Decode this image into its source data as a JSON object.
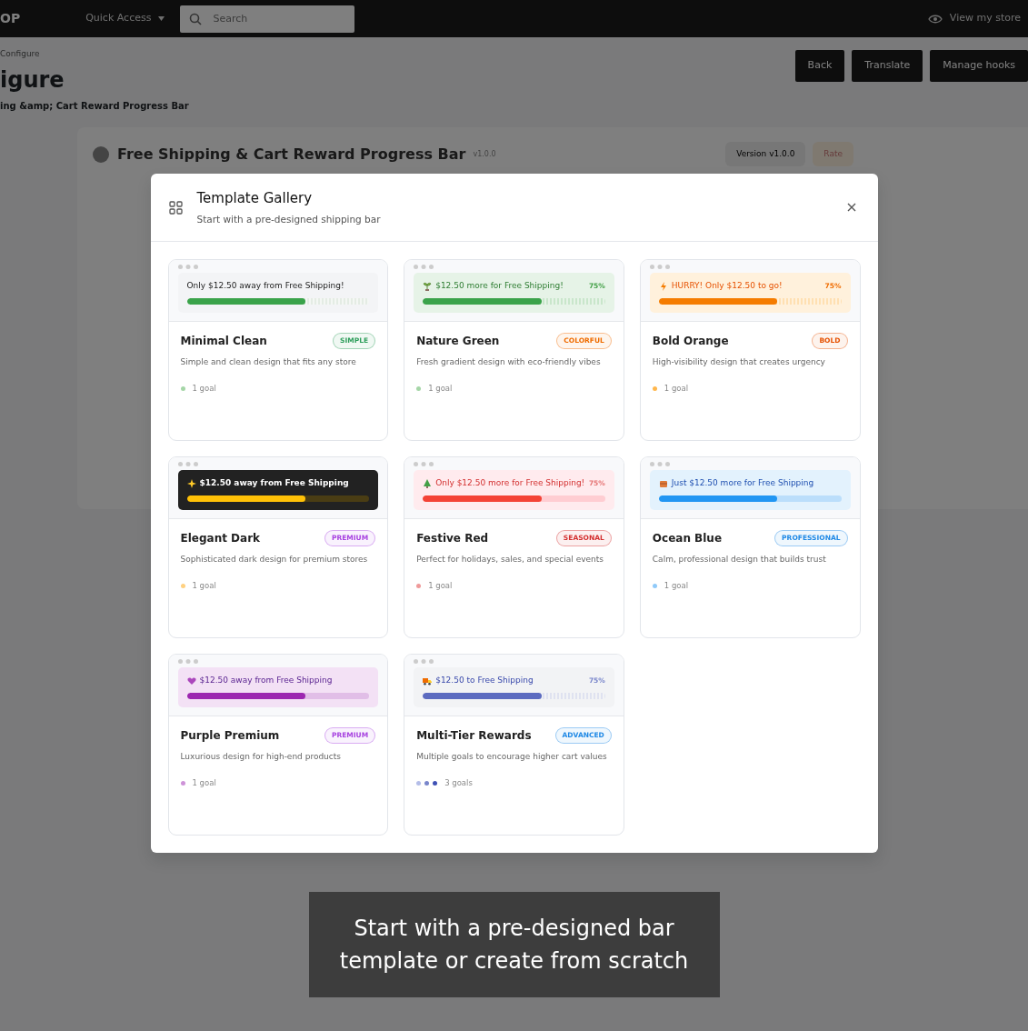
{
  "background": {
    "topbar": {
      "brand": "OP",
      "quick_access": "Quick Access",
      "search_placeholder": "Search",
      "view_store": "View my store"
    },
    "breadcrumb": "Configure",
    "title": "igure",
    "subtitle": "ing &amp; Cart Reward Progress Bar",
    "buttons": [
      "Back",
      "Translate",
      "Manage hooks"
    ],
    "module": {
      "name": "Free Shipping & Cart Reward Progress Bar",
      "version": "v1.0.0",
      "version_button": "Version v1.0.0",
      "rate_button": "Rate"
    }
  },
  "modal": {
    "title": "Template Gallery",
    "subtitle": "Start with a pre-designed shipping bar",
    "templates": [
      {
        "kind": "minimal",
        "message": "Only $12.50 away from Free Shipping!",
        "level": 0.65,
        "color": "#3aa34a",
        "name": "Minimal Clean",
        "badge": {
          "label": "SIMPLE",
          "color": "#2e9e5b"
        },
        "description": "Simple and clean design that fits any store",
        "goal_dots": [
          {
            "color": "#a5d6a7"
          }
        ],
        "goals": "1 goal"
      },
      {
        "kind": "nature",
        "message": "$12.50 more for Free Shipping!",
        "percent": "75%",
        "level": 0.65,
        "color": "#3aa34a",
        "name": "Nature Green",
        "badge": {
          "label": "COLORFUL",
          "color": "#ef6c00"
        },
        "description": "Fresh gradient design with eco-friendly vibes",
        "goal_dots": [
          {
            "color": "#a5d6a7"
          }
        ],
        "goals": "1 goal"
      },
      {
        "kind": "orange",
        "message": "HURRY! Only $12.50 to go!",
        "percent": "75%",
        "level": 0.65,
        "color": "#f57c00",
        "name": "Bold Orange",
        "badge": {
          "label": "BOLD",
          "color": "#e65100"
        },
        "description": "High-visibility design that creates urgency",
        "goal_dots": [
          {
            "color": "#ffb74d"
          }
        ],
        "goals": "1 goal"
      },
      {
        "kind": "dark",
        "message": "$12.50 away from Free Shipping",
        "level": 0.65,
        "color": "#ffc107",
        "name": "Elegant Dark",
        "badge": {
          "label": "PREMIUM",
          "color": "#a742e0"
        },
        "description": "Sophisticated dark design for premium stores",
        "goal_dots": [
          {
            "color": "#ffd180"
          }
        ],
        "goals": "1 goal"
      },
      {
        "kind": "red",
        "message": "Only $12.50 more for Free Shipping!",
        "percent": "75%",
        "level": 0.65,
        "color": "#f44336",
        "name": "Festive Red",
        "badge": {
          "label": "SEASONAL",
          "color": "#d32f2f"
        },
        "description": "Perfect for holidays, sales, and special events",
        "goal_dots": [
          {
            "color": "#ef9a9a"
          }
        ],
        "goals": "1 goal"
      },
      {
        "kind": "blue",
        "message": "Just $12.50 more for Free Shipping",
        "level": 0.65,
        "color": "#2196f3",
        "name": "Ocean Blue",
        "badge": {
          "label": "PROFESSIONAL",
          "color": "#1e88e5"
        },
        "description": "Calm, professional design that builds trust",
        "goal_dots": [
          {
            "color": "#90caf9"
          }
        ],
        "goals": "1 goal"
      },
      {
        "kind": "purple",
        "message": "$12.50 away from Free Shipping",
        "level": 0.65,
        "color": "#9c27b0",
        "name": "Purple Premium",
        "badge": {
          "label": "PREMIUM",
          "color": "#a742e0"
        },
        "description": "Luxurious design for high-end products",
        "goal_dots": [
          {
            "color": "#ce93d8"
          }
        ],
        "goals": "1 goal"
      },
      {
        "kind": "multi",
        "message": "$12.50 to Free Shipping",
        "percent": "75%",
        "level": 0.65,
        "color": "#5c6bc0",
        "name": "Multi-Tier Rewards",
        "badge": {
          "label": "ADVANCED",
          "color": "#1e88e5"
        },
        "description": "Multiple goals to encourage higher cart values",
        "goal_dots": [
          {
            "color": "#b4bde8"
          },
          {
            "color": "#7986cb"
          },
          {
            "color": "#3f51b5"
          }
        ],
        "goals": "3 goals"
      }
    ]
  },
  "caption": "Start with a pre-designed bar template or create from scratch"
}
